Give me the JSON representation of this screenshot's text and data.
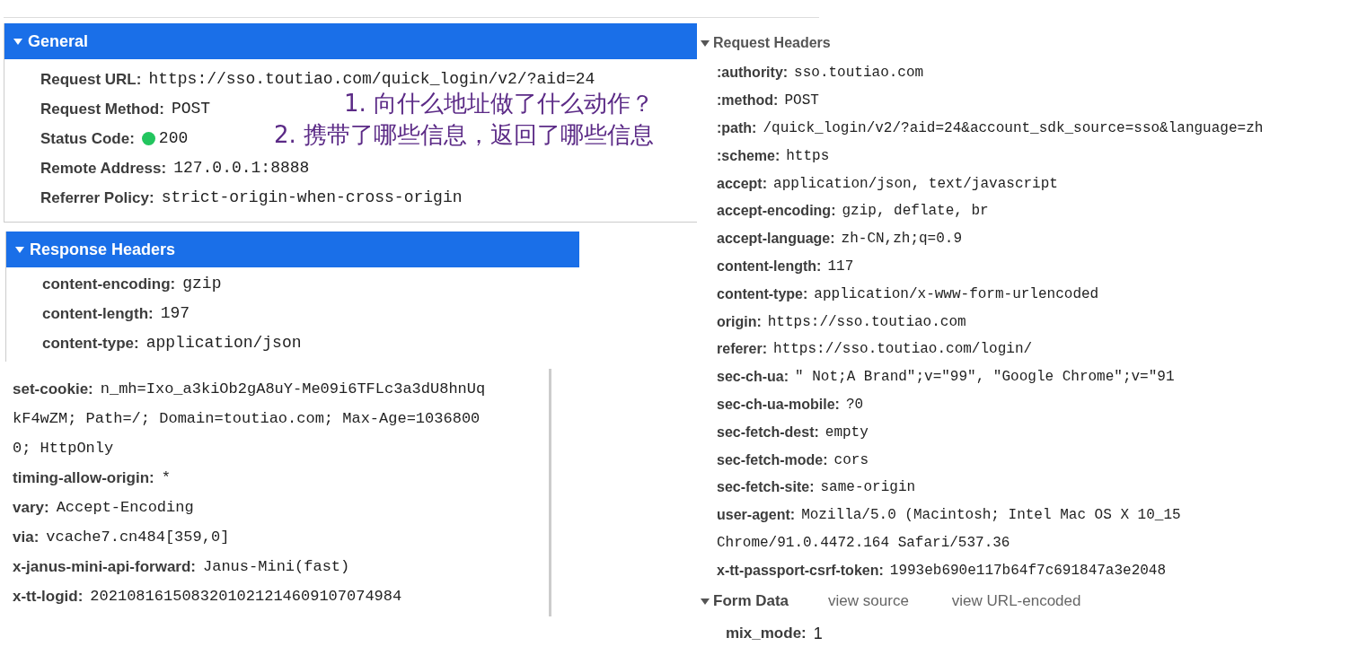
{
  "general": {
    "title": "General",
    "expanded": true,
    "rows": [
      {
        "kind": "text",
        "name": "Request URL:",
        "value": "https://sso.toutiao.com/quick_login/v2/?aid=24"
      },
      {
        "kind": "text",
        "name": "Request Method:",
        "value": "POST"
      },
      {
        "kind": "status",
        "name": "Status Code:",
        "value": "200",
        "color": "#22c55e"
      },
      {
        "kind": "text",
        "name": "Remote Address:",
        "value": "127.0.0.1:8888"
      },
      {
        "kind": "text",
        "name": "Referrer Policy:",
        "value": "strict-origin-when-cross-origin"
      }
    ],
    "notes": [
      "1. 向什么地址做了什么动作？",
      "2. 携带了哪些信息，返回了哪些信息"
    ]
  },
  "response_headers": {
    "title": "Response Headers",
    "expanded": true,
    "rows": [
      {
        "name": "content-encoding:",
        "value": "gzip"
      },
      {
        "name": "content-length:",
        "value": "197"
      },
      {
        "name": "content-type:",
        "value": "application/json"
      }
    ]
  },
  "response_headers_more": {
    "rows": [
      {
        "name": "set-cookie:",
        "value": "n_mh=Ixo_a3kiOb2gA8uY-Me09i6TFLc3a3dU8hnUq",
        "continuation": [
          "kF4wZM; Path=/; Domain=toutiao.com; Max-Age=1036800",
          "0; HttpOnly"
        ]
      },
      {
        "name": "timing-allow-origin:",
        "value": "*"
      },
      {
        "name": "vary:",
        "value": "Accept-Encoding"
      },
      {
        "name": "via:",
        "value": "vcache7.cn484[359,0]"
      },
      {
        "name": "x-janus-mini-api-forward:",
        "value": "Janus-Mini(fast)"
      },
      {
        "name": "x-tt-logid:",
        "value": "2021081615083201021214609107074984"
      }
    ]
  },
  "request_headers": {
    "title": "Request Headers",
    "expanded": true,
    "rows": [
      {
        "name": ":authority:",
        "value": "sso.toutiao.com"
      },
      {
        "name": ":method:",
        "value": "POST"
      },
      {
        "name": ":path:",
        "value": "/quick_login/v2/?aid=24&account_sdk_source=sso&language=zh"
      },
      {
        "name": ":scheme:",
        "value": "https"
      },
      {
        "name": "accept:",
        "value": "application/json, text/javascript"
      },
      {
        "name": "accept-encoding:",
        "value": "gzip, deflate, br"
      },
      {
        "name": "accept-language:",
        "value": "zh-CN,zh;q=0.9"
      },
      {
        "name": "content-length:",
        "value": "117"
      },
      {
        "name": "content-type:",
        "value": "application/x-www-form-urlencoded"
      },
      {
        "name": "origin:",
        "value": "https://sso.toutiao.com"
      },
      {
        "name": "referer:",
        "value": "https://sso.toutiao.com/login/"
      },
      {
        "name": "sec-ch-ua:",
        "value": "\" Not;A Brand\";v=\"99\", \"Google Chrome\";v=\"91"
      },
      {
        "name": "sec-ch-ua-mobile:",
        "value": "?0"
      },
      {
        "name": "sec-fetch-dest:",
        "value": "empty"
      },
      {
        "name": "sec-fetch-mode:",
        "value": "cors"
      },
      {
        "name": "sec-fetch-site:",
        "value": "same-origin"
      },
      {
        "name": "user-agent:",
        "value": "Mozilla/5.0 (Macintosh; Intel Mac OS X 10_15",
        "continuation": "Chrome/91.0.4472.164 Safari/537.36"
      },
      {
        "name": "x-tt-passport-csrf-token:",
        "value": "1993eb690e117b64f7c691847a3e2048"
      }
    ]
  },
  "form_data": {
    "title": "Form Data",
    "expanded": true,
    "links": [
      "view source",
      "view URL-encoded"
    ],
    "rows": [
      {
        "name": "mix_mode:",
        "value": "1"
      }
    ]
  }
}
